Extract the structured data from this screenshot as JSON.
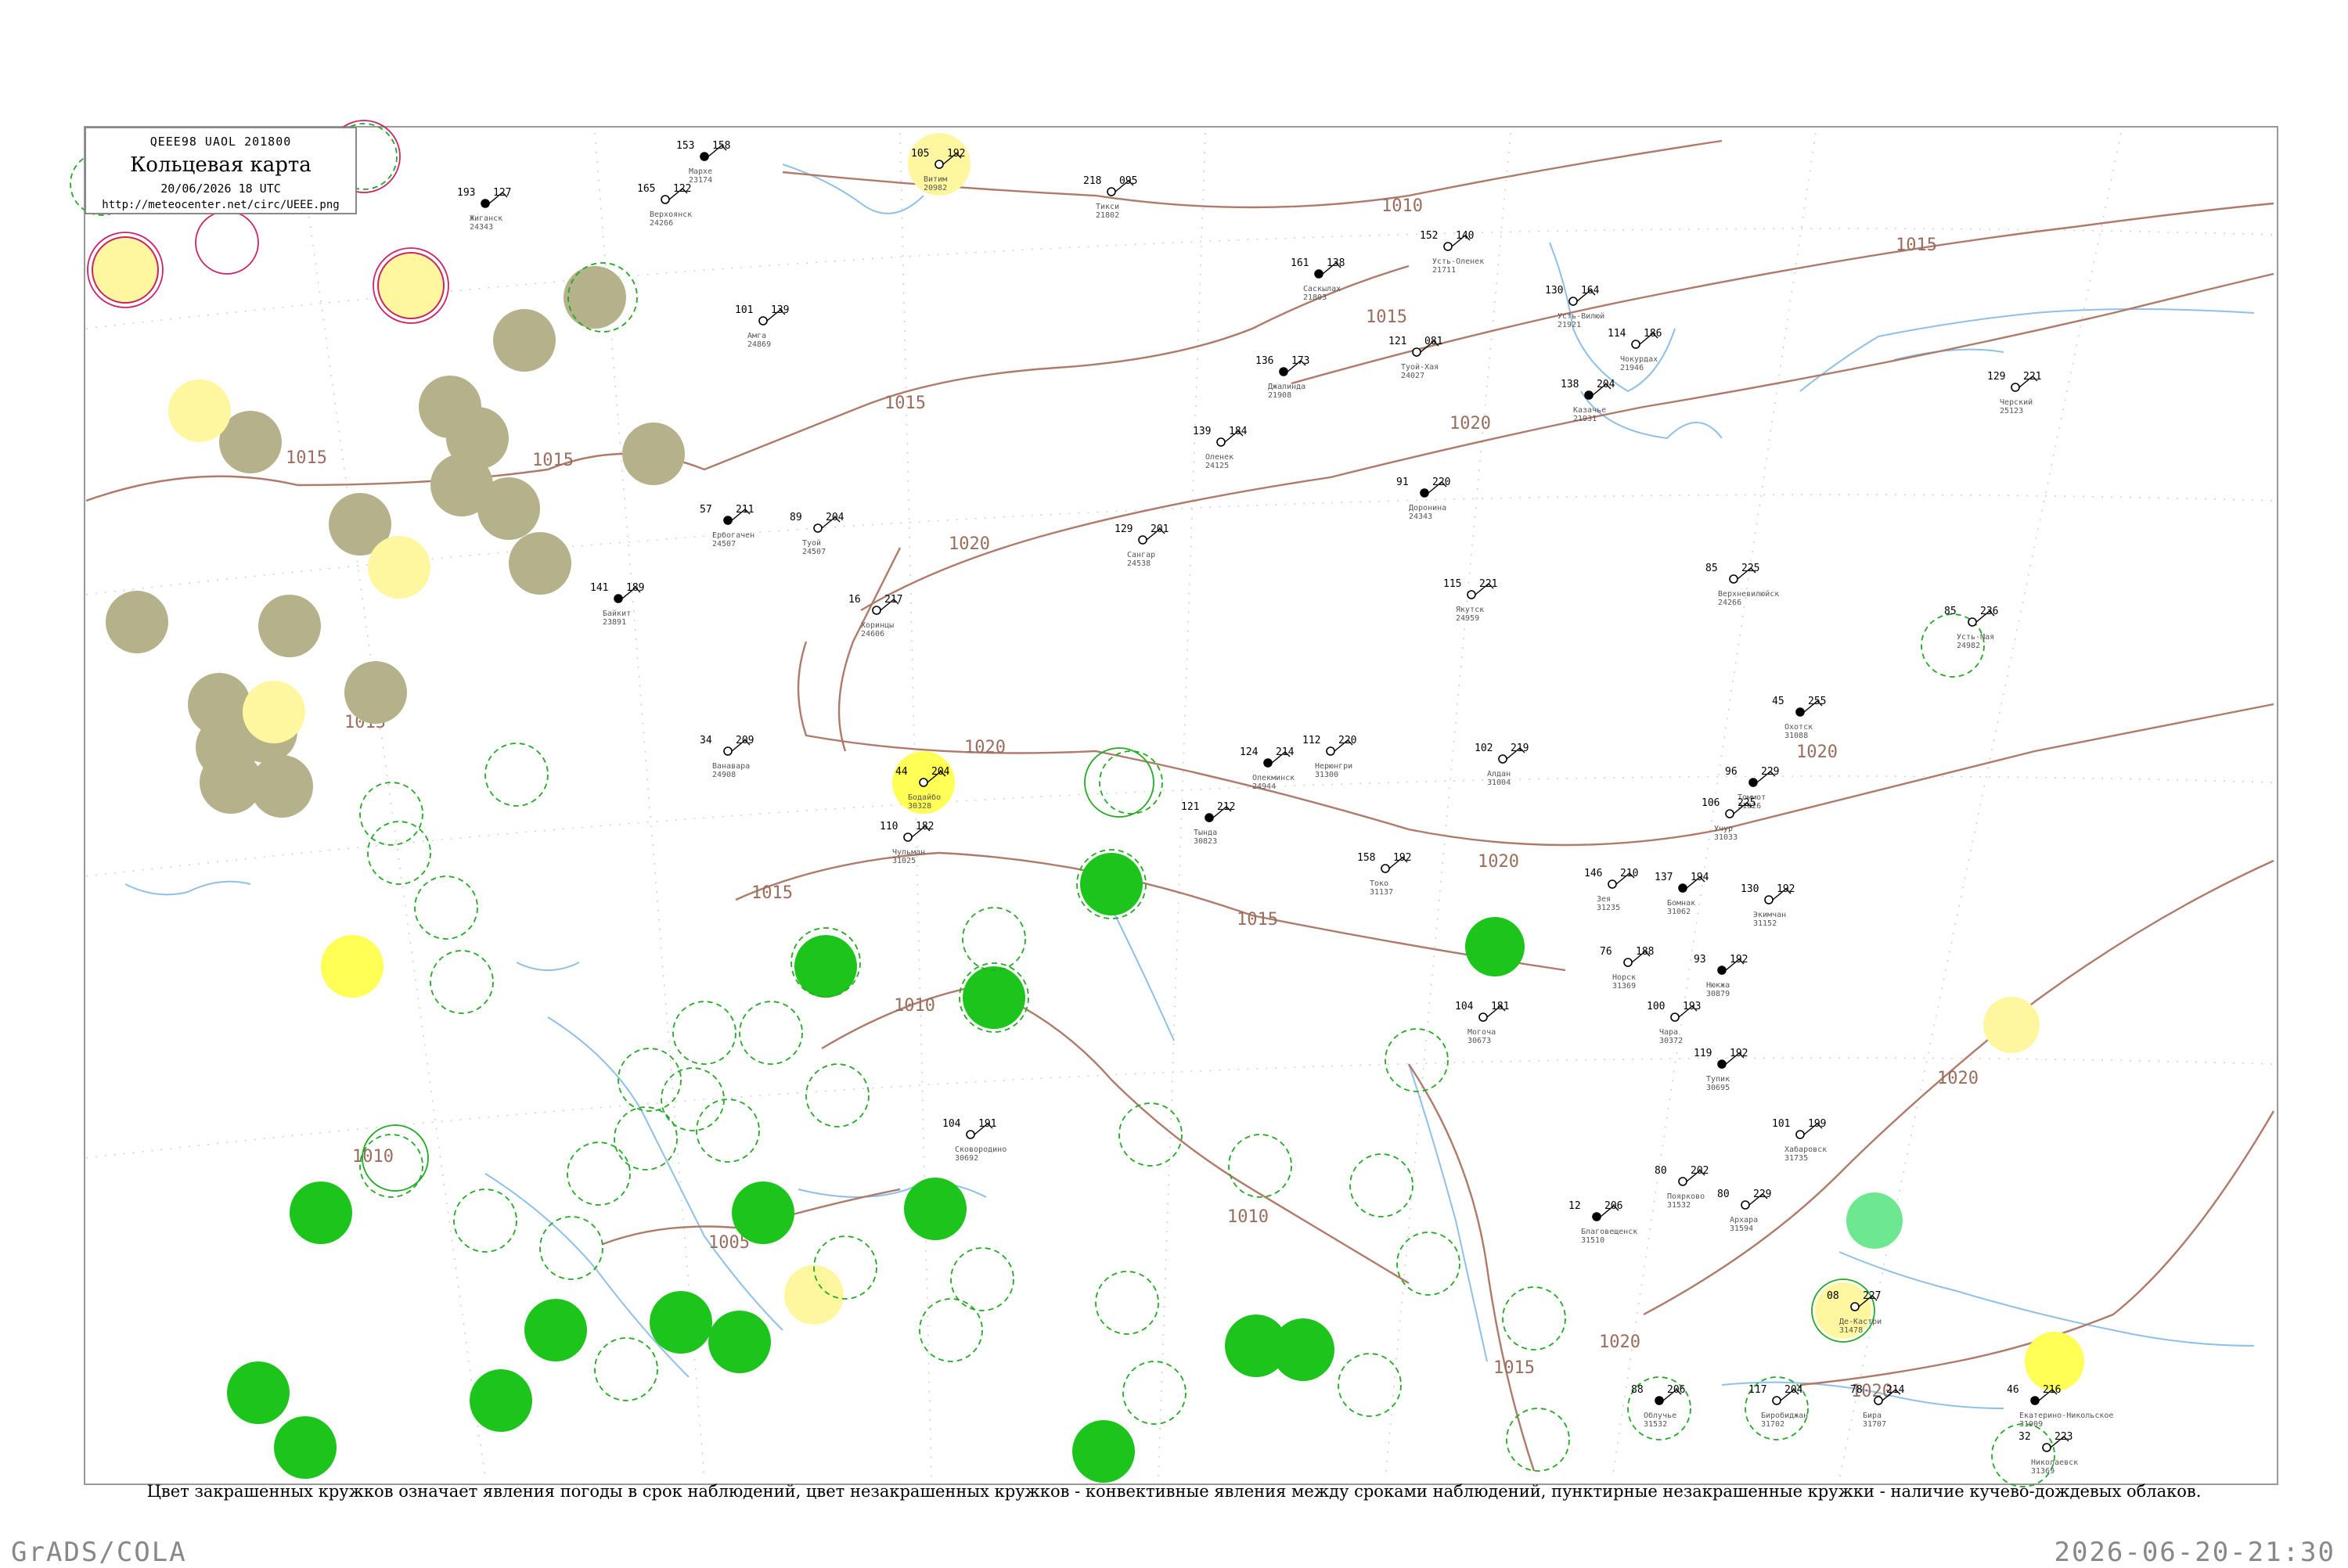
{
  "legend": {
    "code_line": "QEEE98  UAOL  201800",
    "title": "Кольцевая карта",
    "date": "20/06/2026 18 UTC",
    "url": "http://meteocenter.net/circ/UEEE.png"
  },
  "caption": "Цвет закрашенных кружков означает явления погоды в срок наблюдений, цвет незакрашенных кружков - конвективные явления между сроками наблюдений, пунктирные незакрашенные кружки - наличие кучево-дождевых облаков.",
  "footer": {
    "left": "GrADS/COLA",
    "right": "2026-06-20-21:30"
  },
  "colors": {
    "isobar": "#b07a6a",
    "river": "#8fc0e8",
    "olive": "#b5b18a",
    "yellow": "#ffff55",
    "light_yellow": "#fff7a0",
    "green": "#1cc41c",
    "light_green": "#6ee890",
    "cb_ring": "#22aa22",
    "thunder_ring": "#cc2266"
  },
  "isobar_labels": [
    "1010",
    "1015",
    "1015",
    "1015",
    "1020",
    "1015",
    "1020",
    "1020",
    "1015",
    "1020",
    "1015",
    "1010",
    "1010",
    "1015",
    "1010",
    "1005",
    "1020",
    "1020",
    "1020",
    "1015",
    "1015",
    "1020"
  ],
  "stations": [
    {
      "p": "158",
      "t": "153",
      "name": "Мархе",
      "id": "23174"
    },
    {
      "p": "192",
      "t": "105",
      "name": "Витим",
      "id": "20982"
    },
    {
      "p": "095",
      "t": "218",
      "name": "Тикси",
      "id": "21802"
    },
    {
      "p": "127",
      "t": "193",
      "name": "Жиганск",
      "id": "24343"
    },
    {
      "p": "122",
      "t": "165",
      "name": "Верхоянск",
      "id": "24266"
    },
    {
      "p": "140",
      "t": "152",
      "name": "Усть-Оленек",
      "id": "21711"
    },
    {
      "p": "138",
      "t": "161",
      "name": "Саскылах",
      "id": "21803"
    },
    {
      "p": "164",
      "t": "130",
      "name": "Усть-Вилюй",
      "id": "21921"
    },
    {
      "p": "139",
      "t": "101",
      "name": "Амга",
      "id": "24869"
    },
    {
      "p": "173",
      "t": "136",
      "name": "Джалинда",
      "id": "21908"
    },
    {
      "p": "081",
      "t": "121",
      "name": "Туой-Хая",
      "id": "24027"
    },
    {
      "p": "186",
      "t": "114",
      "name": "Чокурдах",
      "id": "21946"
    },
    {
      "p": "204",
      "t": "138",
      "name": "Казачье",
      "id": "21931"
    },
    {
      "p": "221",
      "t": "129",
      "name": "Черский",
      "id": "25123"
    },
    {
      "p": "184",
      "t": "139",
      "name": "Оленек",
      "id": "24125"
    },
    {
      "p": "220",
      "t": "91",
      "name": "Доронина",
      "id": "24343"
    },
    {
      "p": "201",
      "t": "129",
      "name": "Сангар",
      "id": "24538"
    },
    {
      "p": "204",
      "t": "89",
      "name": "Туой",
      "id": "24507"
    },
    {
      "p": "211",
      "t": "57",
      "name": "Ербогачен",
      "id": "24507"
    },
    {
      "p": "225",
      "t": "85",
      "name": "Верхневилюйск",
      "id": "24266"
    },
    {
      "p": "217",
      "t": "16",
      "name": "Хоринцы",
      "id": "24606"
    },
    {
      "p": "189",
      "t": "141",
      "name": "Байкит",
      "id": "23891"
    },
    {
      "p": "221",
      "t": "115",
      "name": "Якутск",
      "id": "24959"
    },
    {
      "p": "236",
      "t": "85",
      "name": "Усть-Мая",
      "id": "24982"
    },
    {
      "p": "255",
      "t": "45",
      "name": "Охотск",
      "id": "31088"
    },
    {
      "p": "209",
      "t": "34",
      "name": "Ванавара",
      "id": "24908"
    },
    {
      "p": "204",
      "t": "44",
      "name": "Бодайбо",
      "id": "30328"
    },
    {
      "p": "214",
      "t": "124",
      "name": "Олекминск",
      "id": "24944"
    },
    {
      "p": "220",
      "t": "112",
      "name": "Нерюнгри",
      "id": "31300"
    },
    {
      "p": "219",
      "t": "102",
      "name": "Алдан",
      "id": "31004"
    },
    {
      "p": "229",
      "t": "96",
      "name": "Томмот",
      "id": "31026"
    },
    {
      "p": "225",
      "t": "106",
      "name": "Учур",
      "id": "31033"
    },
    {
      "p": "182",
      "t": "110",
      "name": "Чульман",
      "id": "31025"
    },
    {
      "p": "212",
      "t": "121",
      "name": "Тында",
      "id": "30823"
    },
    {
      "p": "192",
      "t": "158",
      "name": "Токо",
      "id": "31137"
    },
    {
      "p": "210",
      "t": "146",
      "name": "Зея",
      "id": "31235"
    },
    {
      "p": "194",
      "t": "137",
      "name": "Бомнак",
      "id": "31062"
    },
    {
      "p": "192",
      "t": "130",
      "name": "Экимчан",
      "id": "31152"
    },
    {
      "p": "188",
      "t": "76",
      "name": "Норск",
      "id": "31369"
    },
    {
      "p": "192",
      "t": "93",
      "name": "Нюкжа",
      "id": "30879"
    },
    {
      "p": "181",
      "t": "104",
      "name": "Могоча",
      "id": "30673"
    },
    {
      "p": "193",
      "t": "100",
      "name": "Чара",
      "id": "30372"
    },
    {
      "p": "192",
      "t": "119",
      "name": "Тупик",
      "id": "30695"
    },
    {
      "p": "191",
      "t": "104",
      "name": "Сковородино",
      "id": "30692"
    },
    {
      "p": "199",
      "t": "101",
      "name": "Хабаровск",
      "id": "31735"
    },
    {
      "p": "206",
      "t": "12",
      "name": "Благовещенск",
      "id": "31510"
    },
    {
      "p": "202",
      "t": "80",
      "name": "Поярково",
      "id": "31532"
    },
    {
      "p": "229",
      "t": "80",
      "name": "Архара",
      "id": "31594"
    },
    {
      "p": "206",
      "t": "88",
      "name": "Облучье",
      "id": "31532"
    },
    {
      "p": "204",
      "t": "117",
      "name": "Биробиджан",
      "id": "31702"
    },
    {
      "p": "214",
      "t": "78",
      "name": "Бира",
      "id": "31707"
    },
    {
      "p": "216",
      "t": "46",
      "name": "Екатерино-Никольское",
      "id": "31909"
    },
    {
      "p": "223",
      "t": "32",
      "name": "Николаевск",
      "id": "31369"
    },
    {
      "p": "227",
      "t": "08",
      "name": "Де-Кастри",
      "id": "31478"
    }
  ]
}
